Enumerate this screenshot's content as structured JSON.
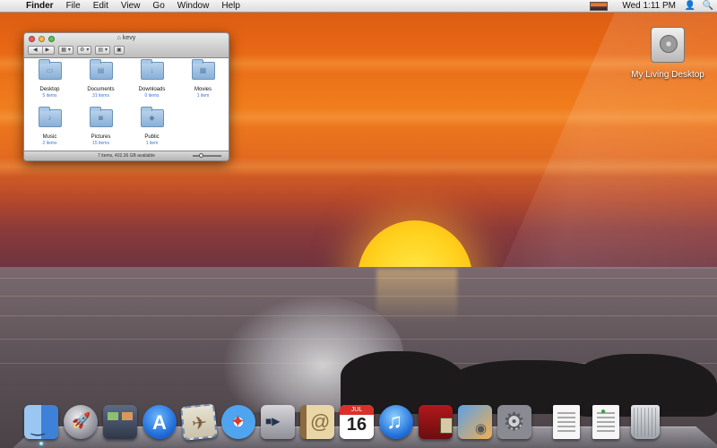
{
  "menubar": {
    "apple_icon": "",
    "app_name": "Finder",
    "items": [
      "File",
      "Edit",
      "View",
      "Go",
      "Window",
      "Help"
    ],
    "clock": "Wed 1:11 PM",
    "user_icon": "👤",
    "spotlight_icon": "🔍"
  },
  "desktop": {
    "disk_label": "My Living Desktop"
  },
  "finder": {
    "title": "kevy",
    "home_icon": "⌂",
    "status": "7 items, 402.36 GB available",
    "zoom_level": 0.25,
    "folders": [
      {
        "name": "Desktop",
        "count": "5 items",
        "glyph": "▭"
      },
      {
        "name": "Documents",
        "count": "31 items",
        "glyph": "▤"
      },
      {
        "name": "Downloads",
        "count": "0 items",
        "glyph": "↓"
      },
      {
        "name": "Movies",
        "count": "1 item",
        "glyph": "▦"
      },
      {
        "name": "Music",
        "count": "2 items",
        "glyph": "♪"
      },
      {
        "name": "Pictures",
        "count": "15 items",
        "glyph": "◙"
      },
      {
        "name": "Public",
        "count": "1 item",
        "glyph": "◆"
      }
    ]
  },
  "dock": {
    "calendar_day": "16",
    "calendar_month": "JUL"
  },
  "colors": {
    "accent": "#3a7ad0",
    "sun": "#ffd21f"
  }
}
